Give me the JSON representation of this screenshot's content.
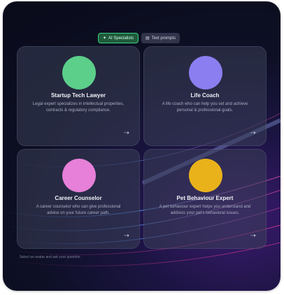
{
  "tabs": [
    {
      "label": "AI Specialists",
      "icon": "sparkle-icon",
      "active": true
    },
    {
      "label": "Text prompts",
      "icon": "document-icon",
      "active": false
    }
  ],
  "cards": [
    {
      "title": "Startup Tech Lawyer",
      "description": "Legal expert specializes in intellectual properties, contracts & regulatory compliance.",
      "color": "#5ccf8a"
    },
    {
      "title": "Life Coach",
      "description": "A life coach who can help you set and achieve personal & professional goals.",
      "color": "#8a7ef0"
    },
    {
      "title": "Career Counselor",
      "description": "A career counselor who can give professional advice on your future career path.",
      "color": "#e680d8"
    },
    {
      "title": "Pet Behaviour Expert",
      "description": "A pet behaviour expert helps you understand and address your pet's behavioral issues.",
      "color": "#e9b21b"
    }
  ],
  "hint": "Select an avatar and ask your question.",
  "colors": {
    "background": "#0d0f24",
    "card": "#3a4058",
    "accent": "#37d47f"
  }
}
